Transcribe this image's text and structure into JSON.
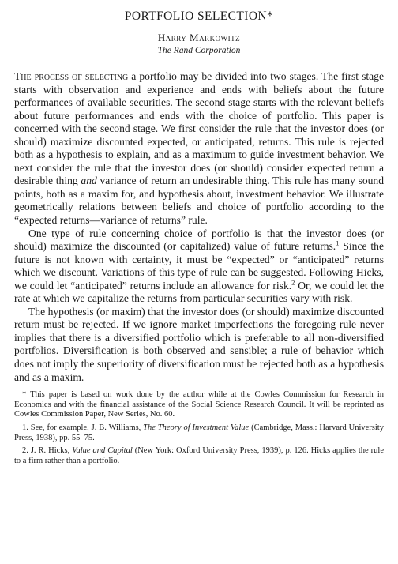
{
  "header": {
    "title": "PORTFOLIO SELECTION*",
    "author": "Harry Markowitz",
    "affiliation": "The Rand Corporation"
  },
  "body": {
    "p1_lead": "The process of selecting",
    "p1_rest_a": " a portfolio may be divided into two stages. The first stage starts with observation and experience and ends with beliefs about the future performances of available securities. The second stage starts with the relevant beliefs about future performances and ends with the choice of portfolio. This paper is concerned with the second stage. We first consider the rule that the investor does (or should) maximize discounted expected, or anticipated, returns. This rule is re­jected both as a hypothesis to explain, and as a maximum to guide in­vestment behavior. We next consider the rule that the investor does (or should) consider expected return a desirable thing ",
    "p1_and": "and",
    "p1_rest_b": " variance of re­turn an undesirable thing. This rule has many sound points, both as a maxim for, and hypothesis about, investment behavior. We illustrate geometrically relations between beliefs and choice of portfolio accord­ing to the “expected returns—variance of returns” rule.",
    "p2_a": "One type of rule concerning choice of portfolio is that the investor does (or should) maximize the discounted (or capitalized) value of future returns.",
    "p2_sup1": "1",
    "p2_b": " Since the future is not known with certainty, it must be “expected” or “anticipated” returns which we discount. Variations of this type of rule can be suggested. Following Hicks, we could let “anticipated” returns include an allowance for risk.",
    "p2_sup2": "2",
    "p2_c": " Or, we could let the rate at which we capitalize the returns from particular securities vary with risk.",
    "p3": "The hypothesis (or maxim) that the investor does (or should) maximize discounted return must be rejected. If we ignore market im­perfections the foregoing rule never implies that there is a diversified portfolio which is preferable to all non-diversified portfolios. Diversi­fication is both observed and sensible; a rule of behavior which does not imply the superiority of diversification must be rejected both as a hypothesis and as a maxim."
  },
  "footnotes": {
    "star": "* This paper is based on work done by the author while at the Cowles Commission for Research in Economics and with the financial assistance of the Social Science Research Council. It will be reprinted as Cowles Commission Paper, New Series, No. 60.",
    "f1_a": "1. See, for example, J. B. Williams, ",
    "f1_title": "The Theory of Investment Value",
    "f1_b": " (Cambridge, Mass.: Harvard University Press, 1938), pp. 55–75.",
    "f2_a": "2. J. R. Hicks, ",
    "f2_title": "Value and Capital",
    "f2_b": " (New York: Oxford University Press, 1939), p. 126. Hicks applies the rule to a firm rather than a portfolio."
  }
}
